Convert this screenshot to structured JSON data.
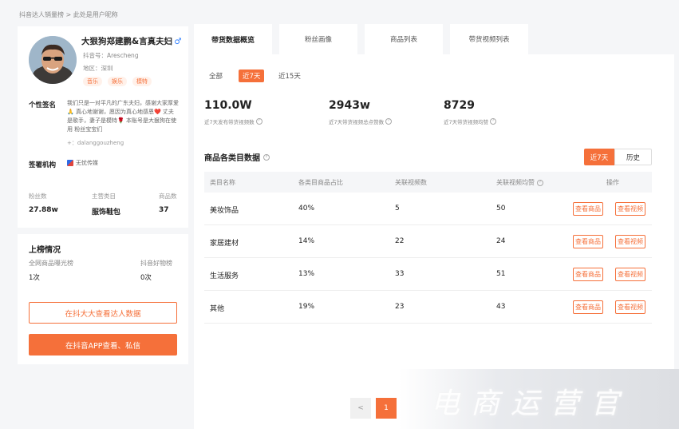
{
  "breadcrumb": "抖音达人销量榜 > 此处是用户昵称",
  "profile": {
    "name": "大狠狗郑建鹏&言真夫妇",
    "gender_symbol": "♂",
    "douyin_id": "抖音号：Arescheng",
    "region": "地区：深圳",
    "tags": [
      "音乐",
      "娱乐",
      "模特"
    ],
    "signature_label": "个性签名",
    "signature_text": "我们只是一对平凡的广东夫妇，感谢大家厚爱🙏 真心地谢谢，愿因为真心地感恩❤️ 丈夫是歌手，妻子是模特🌹 本账号是大狠狗在使用 粉丝宝宝们",
    "signature_id": "+：dalanggouzheng",
    "org_label": "签署机构",
    "org_value": "无忧传媒",
    "stats": [
      {
        "label": "粉丝数",
        "value": "27.88w"
      },
      {
        "label": "主营类目",
        "value": "服饰鞋包"
      },
      {
        "label": "商品数",
        "value": "37"
      }
    ]
  },
  "rank": {
    "title": "上榜情况",
    "items": [
      {
        "label": "全网商品曝光榜",
        "value": "1次"
      },
      {
        "label": "抖音好物榜",
        "value": "0次"
      }
    ],
    "btn_outline": "在抖大大查看达人数据",
    "btn_fill": "在抖音APP查看、私信"
  },
  "tabs": [
    "带货数据概览",
    "粉丝画像",
    "商品列表",
    "带货视频列表"
  ],
  "filters": [
    "全部",
    "近7天",
    "近15天"
  ],
  "metrics": [
    {
      "value": "110.0W",
      "label": "近7天发布带货视频数"
    },
    {
      "value": "2943w",
      "label": "近7天带货视频总点赞数"
    },
    {
      "value": "8729",
      "label": "近7天带货视频均赞"
    }
  ],
  "category": {
    "title": "商品各类目数据",
    "toggle_on": "近7天",
    "toggle_off": "历史",
    "headers": [
      "类目名称",
      "各类目商品占比",
      "关联视频数",
      "关联视频均赞",
      "操作"
    ],
    "rows": [
      [
        "美妆饰品",
        "40%",
        "5",
        "50"
      ],
      [
        "家居建材",
        "14%",
        "22",
        "24"
      ],
      [
        "生活服务",
        "13%",
        "33",
        "51"
      ],
      [
        "其他",
        "19%",
        "23",
        "43"
      ]
    ],
    "op_product": "查看商品",
    "op_video": "查看视频"
  },
  "pager": {
    "prev": "<",
    "current": "1"
  },
  "watermark": "电商运营官",
  "colors": {
    "accent": "#f5703a",
    "gender": "#3a86ff"
  }
}
